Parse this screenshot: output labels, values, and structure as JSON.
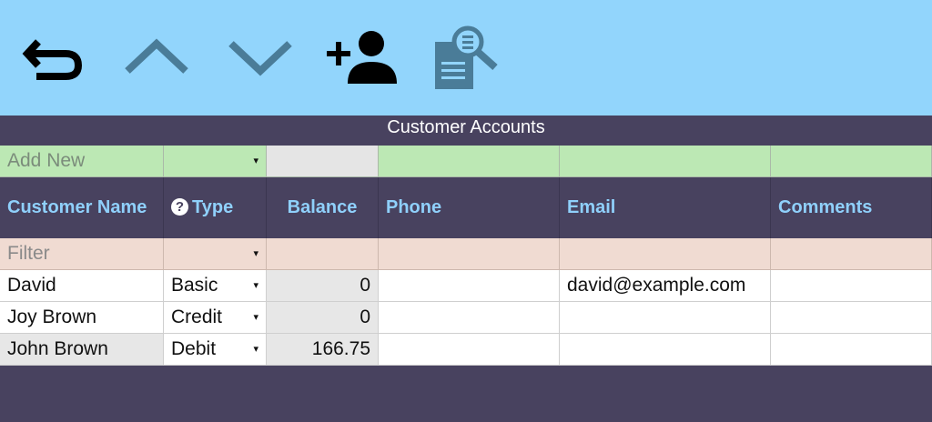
{
  "toolbar": {
    "buttons": [
      {
        "name": "undo-icon"
      },
      {
        "name": "chevron-up-icon"
      },
      {
        "name": "chevron-down-icon"
      },
      {
        "name": "add-user-icon"
      },
      {
        "name": "document-search-icon"
      }
    ]
  },
  "table": {
    "title": "Customer Accounts",
    "add_new_placeholder": "Add New",
    "filter_placeholder": "Filter",
    "help_glyph": "?",
    "dropdown_glyph": "▾",
    "columns": [
      "Customer Name",
      "Type",
      "Balance",
      "Phone",
      "Email",
      "Comments"
    ],
    "rows": [
      {
        "name": "David",
        "type": "Basic",
        "balance": "0",
        "phone": "",
        "email": "david@example.com",
        "comments": ""
      },
      {
        "name": "Joy Brown",
        "type": "Credit",
        "balance": "0",
        "phone": "",
        "email": "",
        "comments": ""
      },
      {
        "name": "John Brown",
        "type": "Debit",
        "balance": "166.75",
        "phone": "",
        "email": "",
        "comments": ""
      }
    ]
  },
  "colors": {
    "toolbar_bg": "#92d5fc",
    "header_bg": "#48425f",
    "header_text": "#8fd0fb",
    "add_row_bg": "#bce8b4",
    "filter_row_bg": "#f0dbd2"
  }
}
